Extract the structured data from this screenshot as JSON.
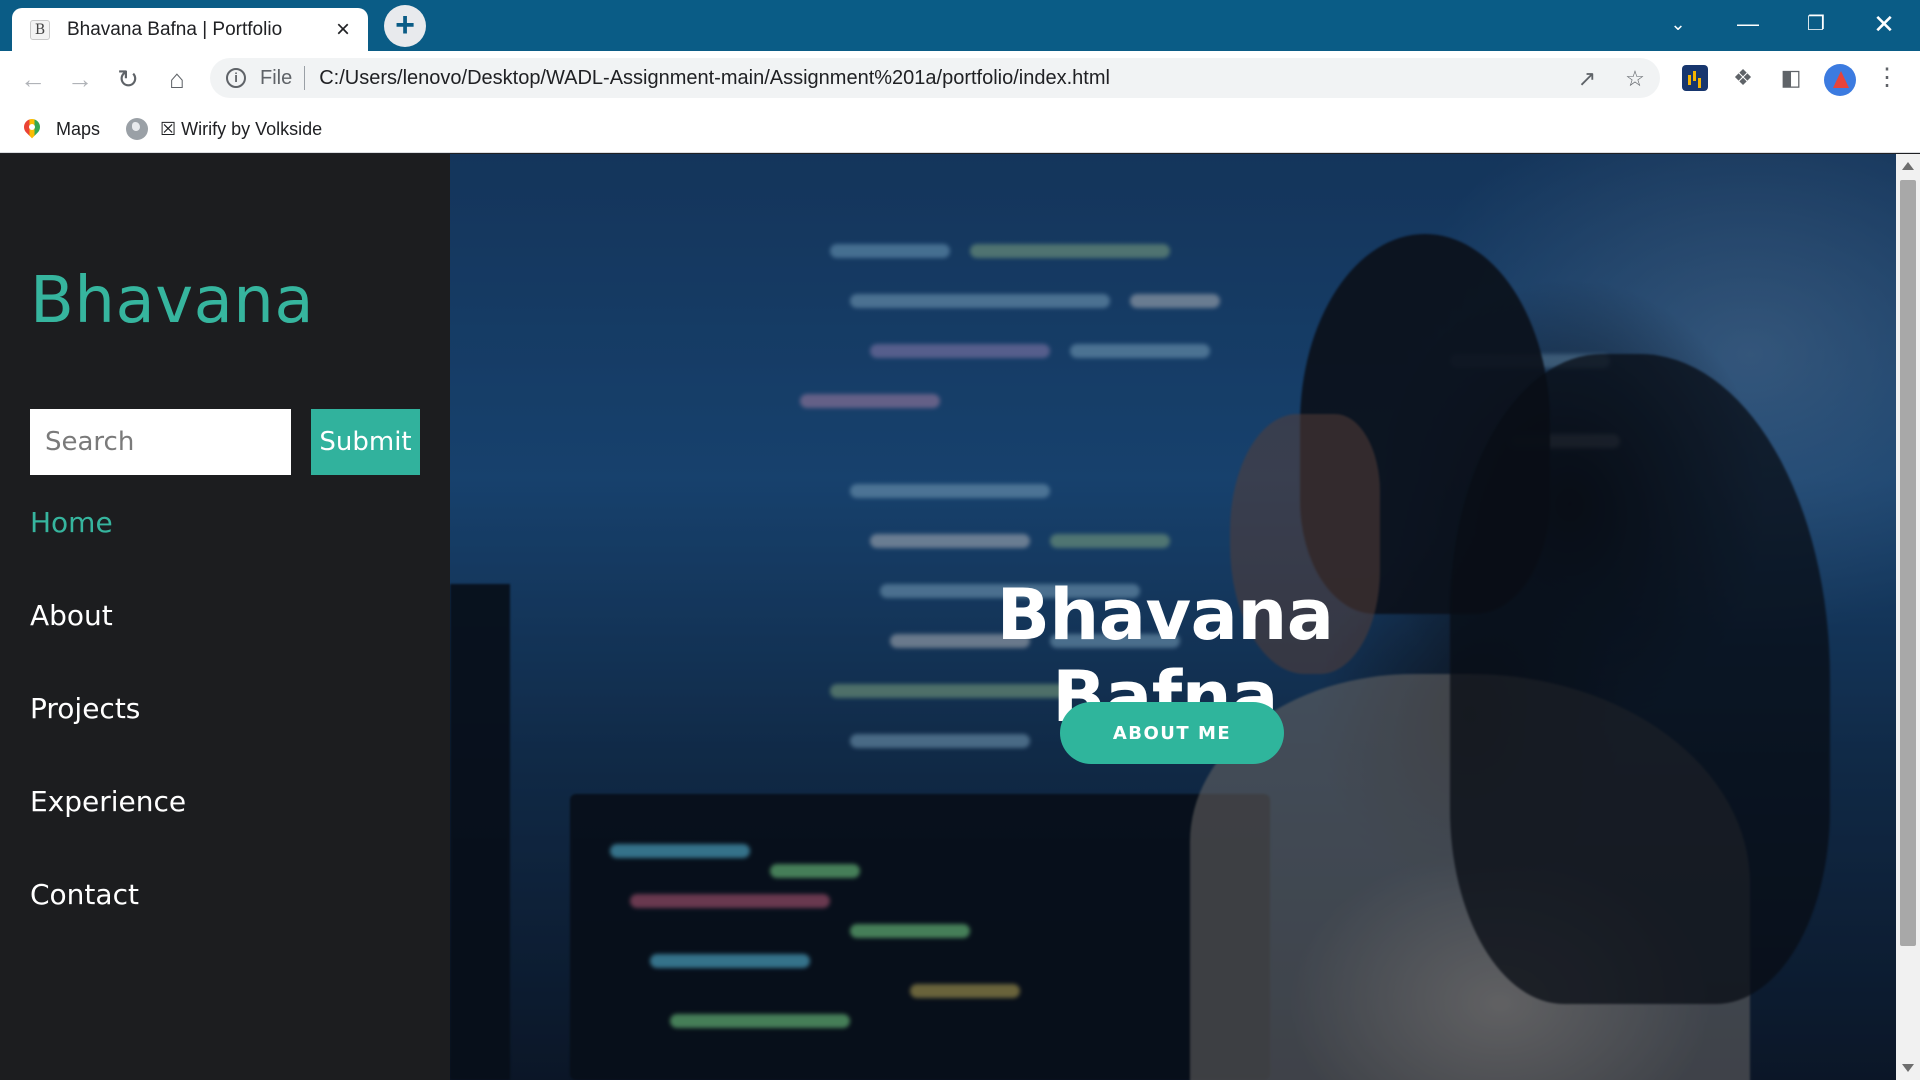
{
  "browser": {
    "tab_title": "Bhavana Bafna | Portfolio",
    "tab_favicon_text": "B",
    "close_icon": "×",
    "new_tab_icon": "+",
    "url_prefix": "File",
    "url": "C:/Users/lenovo/Desktop/WADL-Assignment-main/Assignment%201a/portfolio/index.html",
    "bookmarks": [
      {
        "label": "Maps",
        "icon": "maps-pin-icon"
      },
      {
        "label": "☒ Wirify by Volkside",
        "icon": "globe-icon"
      }
    ]
  },
  "sidebar": {
    "brand": "Bhavana",
    "search": {
      "placeholder": "Search",
      "value": ""
    },
    "submit_label": "Submit",
    "nav": [
      {
        "label": "Home",
        "active": true
      },
      {
        "label": "About",
        "active": false
      },
      {
        "label": "Projects",
        "active": false
      },
      {
        "label": "Experience",
        "active": false
      },
      {
        "label": "Contact",
        "active": false
      }
    ]
  },
  "hero": {
    "title": "Bhavana Bafna",
    "button_label": "ABOUT ME"
  },
  "colors": {
    "accent": "#36b59e",
    "sidebar_bg": "#1c1d1f",
    "tabbar_bg": "#0a5c86"
  }
}
